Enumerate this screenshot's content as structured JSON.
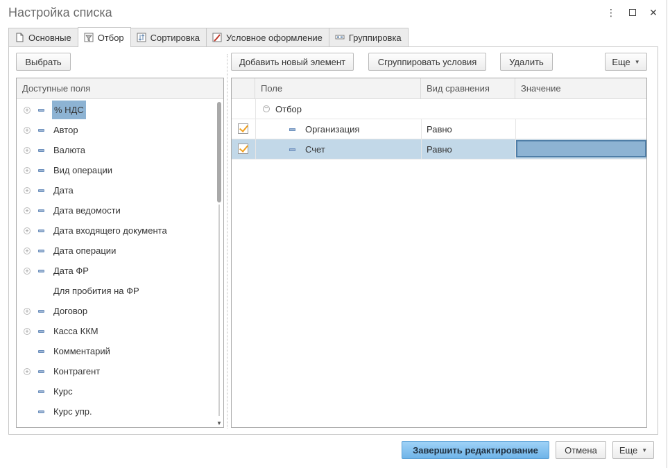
{
  "window": {
    "title": "Настройка списка"
  },
  "tabs": [
    {
      "label": "Основные",
      "icon": "document-icon"
    },
    {
      "label": "Отбор",
      "icon": "filter-icon"
    },
    {
      "label": "Сортировка",
      "icon": "sort-icon"
    },
    {
      "label": "Условное оформление",
      "icon": "brush-icon"
    },
    {
      "label": "Группировка",
      "icon": "group-icon"
    }
  ],
  "left": {
    "select_label": "Выбрать",
    "header": "Доступные поля",
    "fields": [
      {
        "label": "% НДС",
        "expandable": true,
        "field": true,
        "selected": true
      },
      {
        "label": "Автор",
        "expandable": true,
        "field": true
      },
      {
        "label": "Валюта",
        "expandable": true,
        "field": true
      },
      {
        "label": "Вид операции",
        "expandable": true,
        "field": true
      },
      {
        "label": "Дата",
        "expandable": true,
        "field": true
      },
      {
        "label": "Дата ведомости",
        "expandable": true,
        "field": true
      },
      {
        "label": "Дата входящего документа",
        "expandable": true,
        "field": true
      },
      {
        "label": "Дата операции",
        "expandable": true,
        "field": true
      },
      {
        "label": "Дата ФР",
        "expandable": true,
        "field": true
      },
      {
        "label": "Для пробития на ФР",
        "expandable": false,
        "field": false
      },
      {
        "label": "Договор",
        "expandable": true,
        "field": true
      },
      {
        "label": "Касса ККМ",
        "expandable": true,
        "field": true
      },
      {
        "label": "Комментарий",
        "expandable": false,
        "field": true
      },
      {
        "label": "Контрагент",
        "expandable": true,
        "field": true
      },
      {
        "label": "Курс",
        "expandable": false,
        "field": true
      },
      {
        "label": "Курс упр.",
        "expandable": false,
        "field": true
      }
    ]
  },
  "toolbar": {
    "add_label": "Добавить новый элемент",
    "group_label": "Сгруппировать условия",
    "delete_label": "Удалить",
    "more_label": "Еще"
  },
  "grid": {
    "columns": [
      "Поле",
      "Вид сравнения",
      "Значение"
    ],
    "group_row": "Отбор",
    "rows": [
      {
        "field": "Организация",
        "comparison": "Равно",
        "value": "",
        "checked": true
      },
      {
        "field": "Счет",
        "comparison": "Равно",
        "value": "",
        "checked": true,
        "selected": true
      }
    ]
  },
  "footer": {
    "finish_label": "Завершить редактирование",
    "cancel_label": "Отмена",
    "more_label": "Еще"
  },
  "colors": {
    "accent": "#6fb4e8",
    "selection": "#8db3d3",
    "check": "#f0a020"
  }
}
